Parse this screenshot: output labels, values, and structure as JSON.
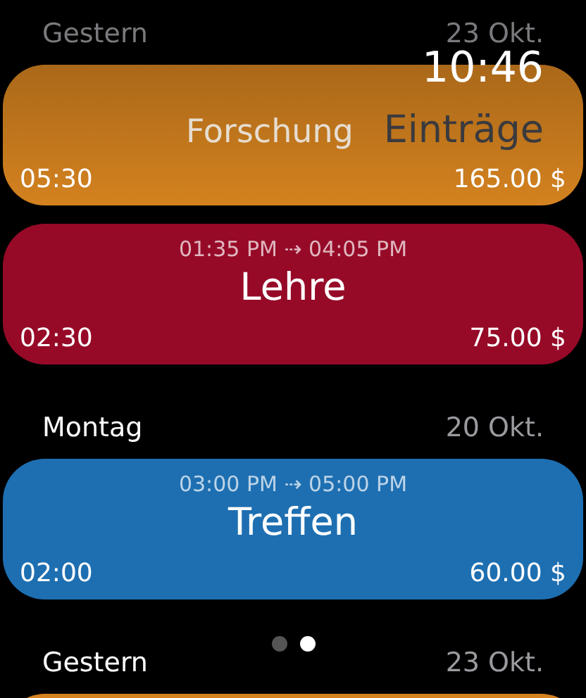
{
  "header": {
    "time": "10:46",
    "title": "Einträge"
  },
  "entries": [
    {
      "kind": "section",
      "day": "Gestern",
      "date": "23 Okt.",
      "blurred": true
    },
    {
      "kind": "card",
      "title": "Forschung",
      "duration": "05:30",
      "price": "165.00 $",
      "color": "#d4821f",
      "blurred": true
    },
    {
      "kind": "card",
      "range": "01:35 PM ⇢ 04:05 PM",
      "title": "Lehre",
      "duration": "02:30",
      "price": "75.00 $",
      "color": "#960a28",
      "blurred": false
    },
    {
      "kind": "section",
      "day": "Montag",
      "date": "20 Okt.",
      "blurred": false
    },
    {
      "kind": "card",
      "range": "03:00 PM ⇢ 05:00 PM",
      "title": "Treffen",
      "duration": "02:00",
      "price": "60.00 $",
      "color": "#1e6fb1",
      "blurred": false
    },
    {
      "kind": "section",
      "day": "Gestern",
      "date": "23 Okt.",
      "blurred": false
    },
    {
      "kind": "card",
      "color": "#d4821f",
      "blurred": false
    }
  ],
  "pages": [
    {
      "selected": false
    },
    {
      "selected": true
    }
  ]
}
